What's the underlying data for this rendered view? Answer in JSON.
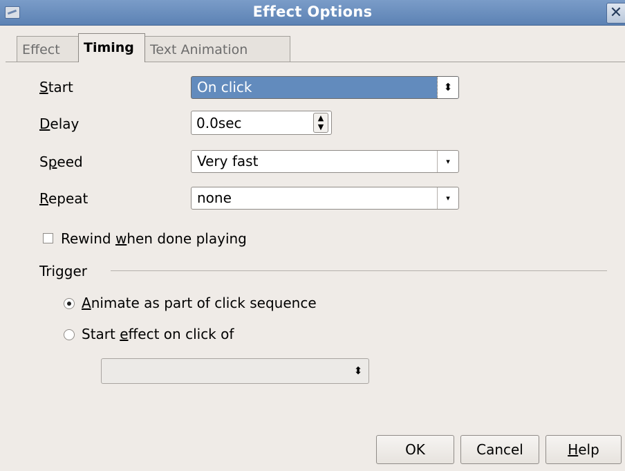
{
  "window": {
    "title": "Effect Options",
    "close_glyph": "✕"
  },
  "tabs": [
    {
      "label": "Effect",
      "active": false
    },
    {
      "label": "Timing",
      "active": true
    },
    {
      "label": "Text Animation",
      "active": false
    }
  ],
  "timing": {
    "start": {
      "label_first": "S",
      "label_rest": "tart",
      "value": "On click"
    },
    "delay": {
      "label_first": "D",
      "label_rest": "elay",
      "value": "0.0sec"
    },
    "speed": {
      "label_pre": "S",
      "label_mid": "p",
      "label_post": "eed",
      "value": "Very fast"
    },
    "repeat": {
      "label_first": "R",
      "label_rest": "epeat",
      "value": "none"
    },
    "rewind": {
      "label_pre": "Rewind ",
      "label_mid": "w",
      "label_post": "hen done playing",
      "checked": false
    }
  },
  "trigger": {
    "heading": "Trigger",
    "animate": {
      "label_first": "A",
      "label_rest": "nimate as part of click sequence",
      "selected": true
    },
    "start_effect": {
      "label_pre": "Start ",
      "label_mid": "e",
      "label_post": "ffect on click of",
      "selected": false
    },
    "shape_value": ""
  },
  "buttons": {
    "ok": "OK",
    "cancel": "Cancel",
    "help_first": "H",
    "help_rest": "elp"
  },
  "icons": {
    "spin_up": "▲",
    "spin_down": "▼",
    "updown": "⬍",
    "dropdown": "▾"
  },
  "colors": {
    "titlebar": "#6a8fc0",
    "selection": "#628bbd",
    "dialog_bg": "#efebe7"
  }
}
